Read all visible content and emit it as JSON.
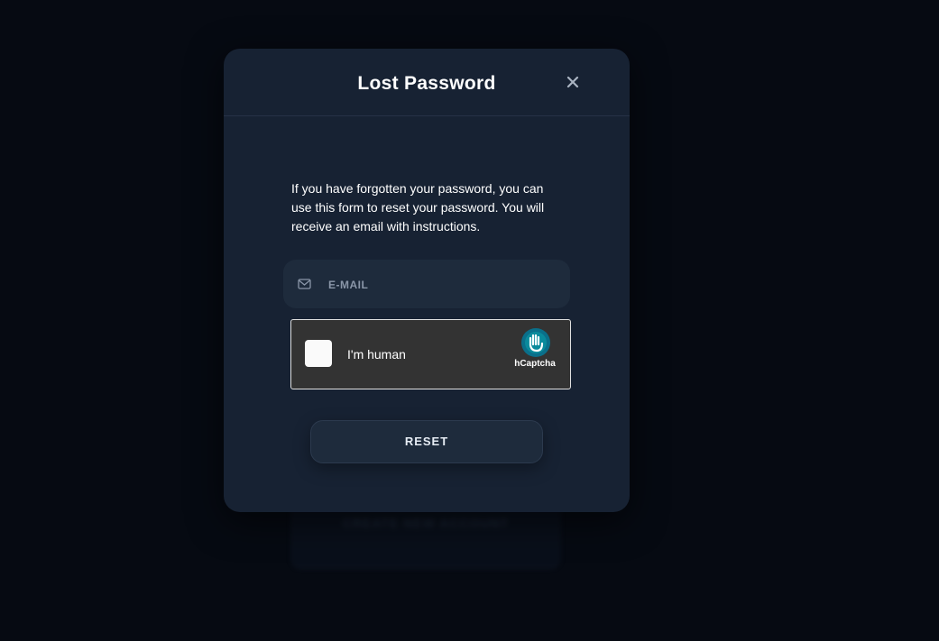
{
  "background": {
    "hidden_button_label": "CREATE NEW ACCOUNT"
  },
  "modal": {
    "title": "Lost Password",
    "close_icon": "close-icon",
    "instructions": "If you have forgotten your password, you can use this form to reset your password. You will receive an email with instructions.",
    "email": {
      "icon": "mail-icon",
      "placeholder": "E-MAIL",
      "value": ""
    },
    "captcha": {
      "label": "I'm human",
      "brand": "hCaptcha",
      "checked": false
    },
    "reset_label": "RESET"
  },
  "colors": {
    "page_background": "#060a12",
    "modal_background": "#172233",
    "input_background": "#1e2b3c",
    "captcha_background": "#333333",
    "captcha_accent": "#0a8a9c"
  }
}
